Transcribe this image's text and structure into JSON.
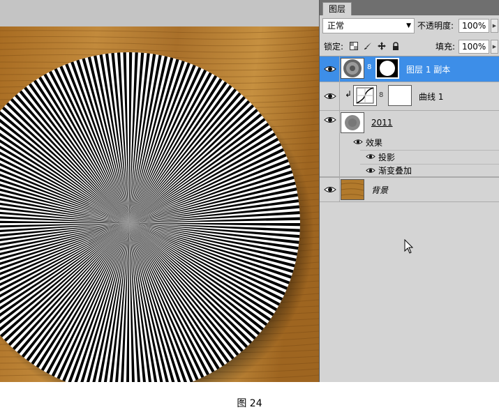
{
  "panel": {
    "tab_label": "图层",
    "blend_mode": "正常",
    "opacity_label": "不透明度:",
    "opacity_value": "100%",
    "lock_label": "锁定:",
    "fill_label": "填充:",
    "fill_value": "100%"
  },
  "layers": [
    {
      "name": "图层 1 副本",
      "selected": true
    },
    {
      "name": "曲线 1"
    },
    {
      "name": "2011"
    },
    {
      "name": "背景"
    }
  ],
  "effects": {
    "label": "效果",
    "items": [
      "投影",
      "渐变叠加"
    ]
  },
  "icons": {
    "visibility": "eye-icon",
    "lock_transparent": "lock-transparency-icon",
    "lock_image": "brush-icon",
    "lock_position": "move-icon",
    "lock_all": "lock-icon",
    "link": "chain-link-icon",
    "clip": "clip-arrow-icon",
    "cursor": "mouse-cursor-icon"
  },
  "colors": {
    "selection": "#3d8ee8",
    "wood": "#b27a2c",
    "panel_bg": "#d4d4d4"
  },
  "caption": "图 24"
}
